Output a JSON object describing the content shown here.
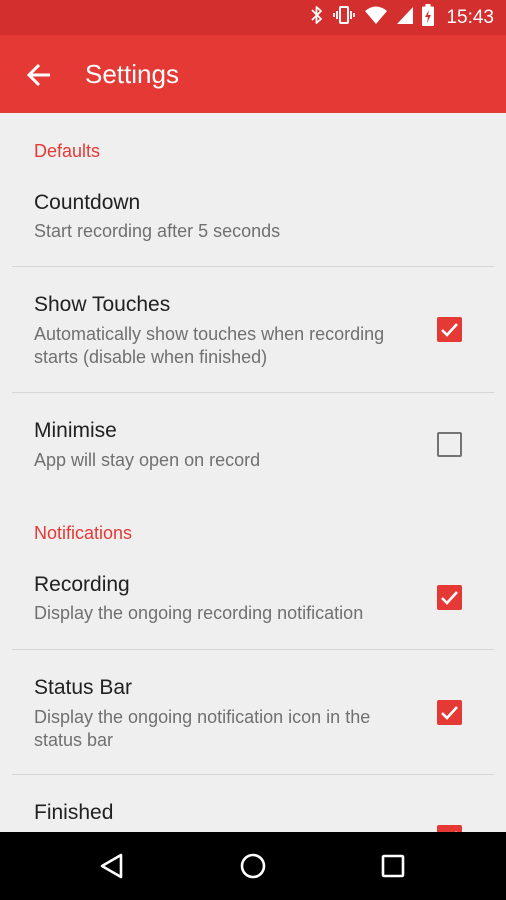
{
  "statusbar": {
    "time": "15:43",
    "icons": [
      "bluetooth-icon",
      "vibrate-icon",
      "wifi-icon",
      "signal-icon",
      "battery-charging-icon"
    ]
  },
  "appbar": {
    "title": "Settings",
    "back_icon": "arrow-left-icon"
  },
  "sections": {
    "defaults": "Defaults",
    "notifications": "Notifications"
  },
  "prefs": {
    "countdown": {
      "title": "Countdown",
      "summary": "Start recording after 5 seconds"
    },
    "show_touches": {
      "title": "Show Touches",
      "summary": "Automatically show touches when recording starts (disable when finished)",
      "checked": true
    },
    "minimise": {
      "title": "Minimise",
      "summary": "App will stay open on record",
      "checked": false
    },
    "recording": {
      "title": "Recording",
      "summary": "Display the ongoing recording notification",
      "checked": true
    },
    "status_bar": {
      "title": "Status Bar",
      "summary": "Display the ongoing notification icon in the status bar",
      "checked": true
    },
    "finished": {
      "title": "Finished",
      "checked": true
    }
  },
  "navbar": {
    "icons": [
      "back-triangle-icon",
      "home-circle-icon",
      "recents-square-icon"
    ]
  },
  "colors": {
    "accent": "#e53935",
    "status_bar": "#d32f2f",
    "background": "#efefef"
  }
}
